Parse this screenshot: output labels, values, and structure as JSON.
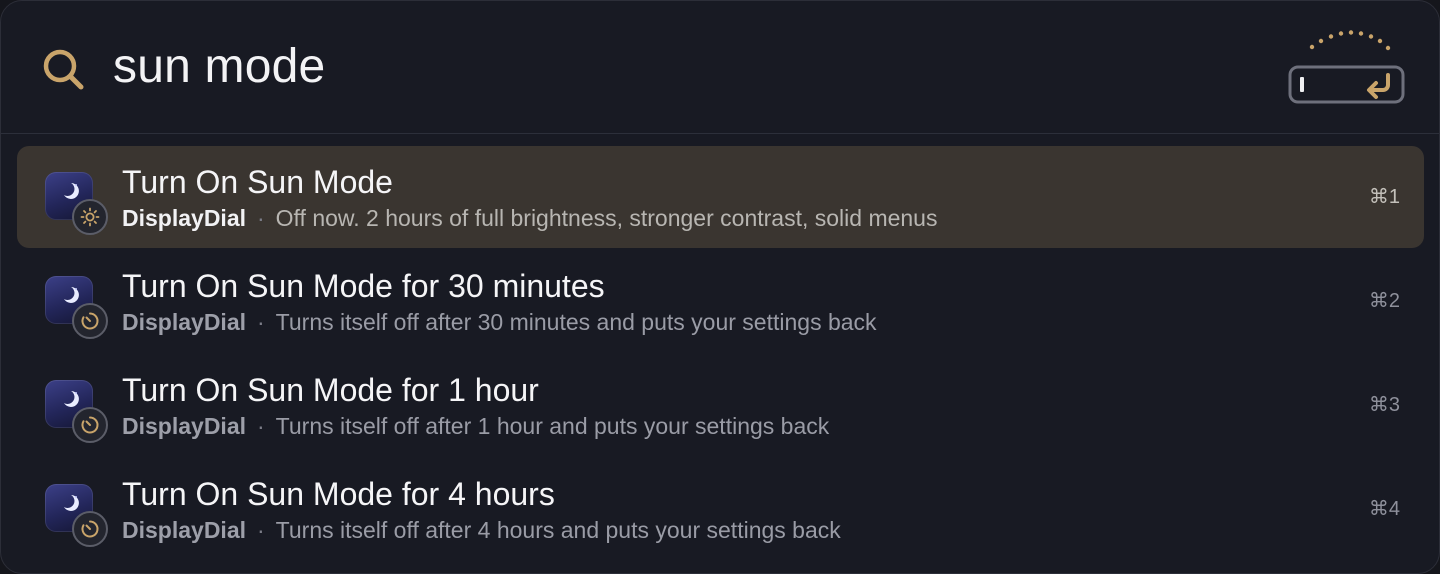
{
  "search": {
    "query": "sun mode",
    "icon": "search-icon",
    "accessory_icon": "return-key-icon"
  },
  "colors": {
    "accent": "#c9a46a",
    "selected_row": "#3a3530",
    "background": "#181a23"
  },
  "results": [
    {
      "title": "Turn On Sun Mode",
      "app": "DisplayDial",
      "separator": "·",
      "description": "Off now. 2 hours of full brightness, stronger contrast, solid menus",
      "shortcut": "⌘1",
      "badge_icon": "sun-icon",
      "selected": true
    },
    {
      "title": "Turn On Sun Mode for 30 minutes",
      "app": "DisplayDial",
      "separator": "·",
      "description": "Turns itself off after 30 minutes and puts your settings back",
      "shortcut": "⌘2",
      "badge_icon": "timer-icon",
      "selected": false
    },
    {
      "title": "Turn On Sun Mode for 1 hour",
      "app": "DisplayDial",
      "separator": "·",
      "description": "Turns itself off after 1 hour and puts your settings back",
      "shortcut": "⌘3",
      "badge_icon": "timer-icon",
      "selected": false
    },
    {
      "title": "Turn On Sun Mode for 4 hours",
      "app": "DisplayDial",
      "separator": "·",
      "description": "Turns itself off after 4 hours and puts your settings back",
      "shortcut": "⌘4",
      "badge_icon": "timer-icon",
      "selected": false
    }
  ]
}
